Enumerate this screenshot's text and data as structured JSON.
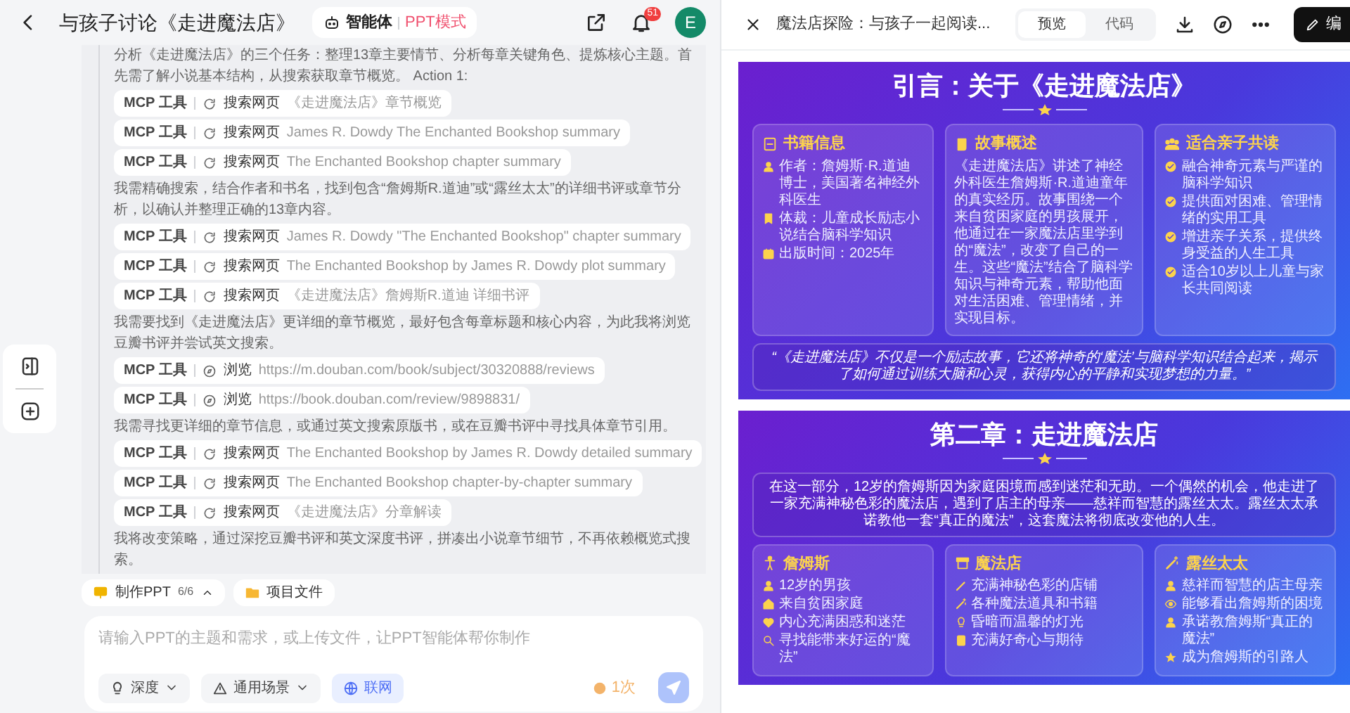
{
  "header": {
    "title": "与孩子讨论《走进魔法店》",
    "agent_label": "智能体",
    "mode": "PPT模式",
    "notification_count": "51",
    "avatar": "E"
  },
  "log": [
    {
      "kind": "text",
      "text": "分析《走进魔法店》的三个任务：整理13章主要情节、分析每章关键角色、提炼核心主题。首先需了解小说基本结构，从搜索获取章节概览。 Action 1:"
    },
    {
      "kind": "search",
      "tool": "MCP 工具",
      "action": "搜索网页",
      "query": "《走进魔法店》章节概览"
    },
    {
      "kind": "search",
      "tool": "MCP 工具",
      "action": "搜索网页",
      "query": "James R. Dowdy The Enchanted Bookshop summary"
    },
    {
      "kind": "search",
      "tool": "MCP 工具",
      "action": "搜索网页",
      "query": "The Enchanted Bookshop chapter summary"
    },
    {
      "kind": "text",
      "text": "我需精确搜索，结合作者和书名，找到包含“詹姆斯R.道迪”或“露丝太太”的详细书评或章节分析，以确认并整理正确的13章内容。"
    },
    {
      "kind": "search",
      "tool": "MCP 工具",
      "action": "搜索网页",
      "query": "James R. Dowdy \"The Enchanted Bookshop\" chapter summary"
    },
    {
      "kind": "search",
      "tool": "MCP 工具",
      "action": "搜索网页",
      "query": "The Enchanted Bookshop by James R. Dowdy plot summary"
    },
    {
      "kind": "search",
      "tool": "MCP 工具",
      "action": "搜索网页",
      "query": "《走进魔法店》詹姆斯R.道迪 详细书评"
    },
    {
      "kind": "text",
      "text": "我需要找到《走进魔法店》更详细的章节概览，最好包含每章标题和核心内容，为此我将浏览豆瓣书评并尝试英文搜索。"
    },
    {
      "kind": "browse",
      "tool": "MCP 工具",
      "action": "浏览",
      "query": "https://m.douban.com/book/subject/30320888/reviews"
    },
    {
      "kind": "browse",
      "tool": "MCP 工具",
      "action": "浏览",
      "query": "https://book.douban.com/review/9898831/"
    },
    {
      "kind": "text",
      "text": "我需寻找更详细的章节信息，或通过英文搜索原版书，或在豆瓣书评中寻找具体章节引用。"
    },
    {
      "kind": "search",
      "tool": "MCP 工具",
      "action": "搜索网页",
      "query": "The Enchanted Bookshop by James R. Dowdy detailed summary"
    },
    {
      "kind": "search",
      "tool": "MCP 工具",
      "action": "搜索网页",
      "query": "The Enchanted Bookshop chapter-by-chapter summary"
    },
    {
      "kind": "search",
      "tool": "MCP 工具",
      "action": "搜索网页",
      "query": "《走进魔法店》分章解读"
    },
    {
      "kind": "text",
      "text": "我将改变策略，通过深挖豆瓣书评和英文深度书评，拼凑出小说章节细节，不再依赖概览式搜索。"
    }
  ],
  "task_bar": {
    "task": "制作PPT",
    "progress": "6/6",
    "files": "项目文件"
  },
  "composer": {
    "placeholder": "请输入PPT的主题和需求，或上传文件，让PPT智能体帮你制作",
    "options": [
      {
        "label": "深度",
        "kind": "dropdown",
        "selected": false
      },
      {
        "label": "通用场景",
        "kind": "dropdown",
        "selected": false
      },
      {
        "label": "联网",
        "kind": "toggle",
        "selected": true
      }
    ],
    "credits": "1次"
  },
  "preview": {
    "title": "魔法店探险：与孩子一起阅读...",
    "tabs": [
      {
        "label": "预览",
        "selected": true
      },
      {
        "label": "代码",
        "selected": false
      }
    ],
    "edit_button": "编",
    "slides": [
      {
        "title": "引言：关于《走进魔法店》",
        "cards": [
          {
            "heading": "书籍信息",
            "items": [
              "作者：詹姆斯·R.道迪博士，美国著名神经外科医生",
              "体裁：儿童成长励志小说结合脑科学知识",
              "出版时间：2025年"
            ]
          },
          {
            "heading": "故事概述",
            "paragraph": "《走进魔法店》讲述了神经外科医生詹姆斯·R.道迪童年的真实经历。故事围绕一个来自贫困家庭的男孩展开，他通过在一家魔法店里学到的“魔法”，改变了自己的一生。这些“魔法”结合了脑科学知识与神奇元素，帮助他面对生活困难、管理情绪，并实现目标。"
          },
          {
            "heading": "适合亲子共读",
            "items": [
              "融合神奇元素与严谨的脑科学知识",
              "提供面对困难、管理情绪的实用工具",
              "增进亲子关系，提供终身受益的人生工具",
              "适合10岁以上儿童与家长共同阅读"
            ]
          }
        ],
        "quote": "“《走进魔法店》不仅是一个励志故事，它还将神奇的‘魔法’与脑科学知识结合起来，揭示了如何通过训练大脑和心灵，获得内心的平静和实现梦想的力量。”"
      },
      {
        "title": "第二章：走进魔法店",
        "intro": "在这一部分，12岁的詹姆斯因为家庭困境而感到迷茫和无助。一个偶然的机会，他走进了一家充满神秘色彩的魔法店，遇到了店主的母亲——慈祥而智慧的露丝太太。露丝太太承诺教他一套“真正的魔法”，这套魔法将彻底改变他的人生。",
        "cards": [
          {
            "heading": "詹姆斯",
            "items": [
              "12岁的男孩",
              "来自贫困家庭",
              "内心充满困惑和迷茫",
              "寻找能带来好运的“魔法”"
            ]
          },
          {
            "heading": "魔法店",
            "items": [
              "充满神秘色彩的店铺",
              "各种魔法道具和书籍",
              "昏暗而温馨的灯光",
              "充满好奇心与期待"
            ]
          },
          {
            "heading": "露丝太太",
            "items": [
              "慈祥而智慧的店主母亲",
              "能够看出詹姆斯的困境",
              "承诺教詹姆斯“真正的魔法”",
              "成为詹姆斯的引路人"
            ]
          }
        ]
      }
    ]
  }
}
